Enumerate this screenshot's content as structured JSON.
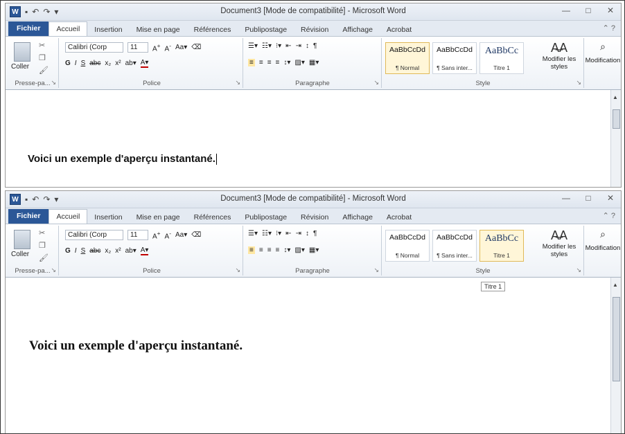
{
  "window1": {
    "title": "Document3 [Mode de compatibilité] - Microsoft Word",
    "tabs": [
      "Fichier",
      "Accueil",
      "Insertion",
      "Mise en page",
      "Références",
      "Publipostage",
      "Révision",
      "Affichage",
      "Acrobat"
    ],
    "active_tab": "Accueil",
    "groups": {
      "clipboard": "Presse-pa...",
      "font": "Police",
      "paragraph": "Paragraphe",
      "style": "Style"
    },
    "clipboard_label": "Coller",
    "font_name": "Calibri (Corp",
    "font_size": "11",
    "styles": [
      {
        "sample": "AaBbCcDd",
        "name": "¶ Normal"
      },
      {
        "sample": "AaBbCcDd",
        "name": "¶ Sans inter..."
      },
      {
        "sample": "AaBbCc",
        "name": "Titre 1"
      }
    ],
    "modify_styles": "Modifier les styles",
    "modification": "Modification",
    "document_text": "Voici un exemple d'aperçu instantané."
  },
  "window2": {
    "title": "Document3 [Mode de compatibilité] - Microsoft Word",
    "tabs": [
      "Fichier",
      "Accueil",
      "Insertion",
      "Mise en page",
      "Références",
      "Publipostage",
      "Révision",
      "Affichage",
      "Acrobat"
    ],
    "active_tab": "Accueil",
    "groups": {
      "clipboard": "Presse-pa...",
      "font": "Police",
      "paragraph": "Paragraphe",
      "style": "Style"
    },
    "clipboard_label": "Coller",
    "font_name": "Calibri (Corp",
    "font_size": "11",
    "styles": [
      {
        "sample": "AaBbCcDd",
        "name": "¶ Normal"
      },
      {
        "sample": "AaBbCcDd",
        "name": "¶ Sans inter..."
      },
      {
        "sample": "AaBbCc",
        "name": "Titre 1"
      }
    ],
    "modify_styles": "Modifier les styles",
    "modification": "Modification",
    "tooltip": "Titre 1",
    "document_text": "Voici un exemple d'aperçu instantané."
  },
  "icons": {
    "word": "W",
    "save": "💾",
    "undo": "↶",
    "redo": "↷",
    "minimize": "—",
    "maximize": "□",
    "close": "✕",
    "help": "?"
  }
}
